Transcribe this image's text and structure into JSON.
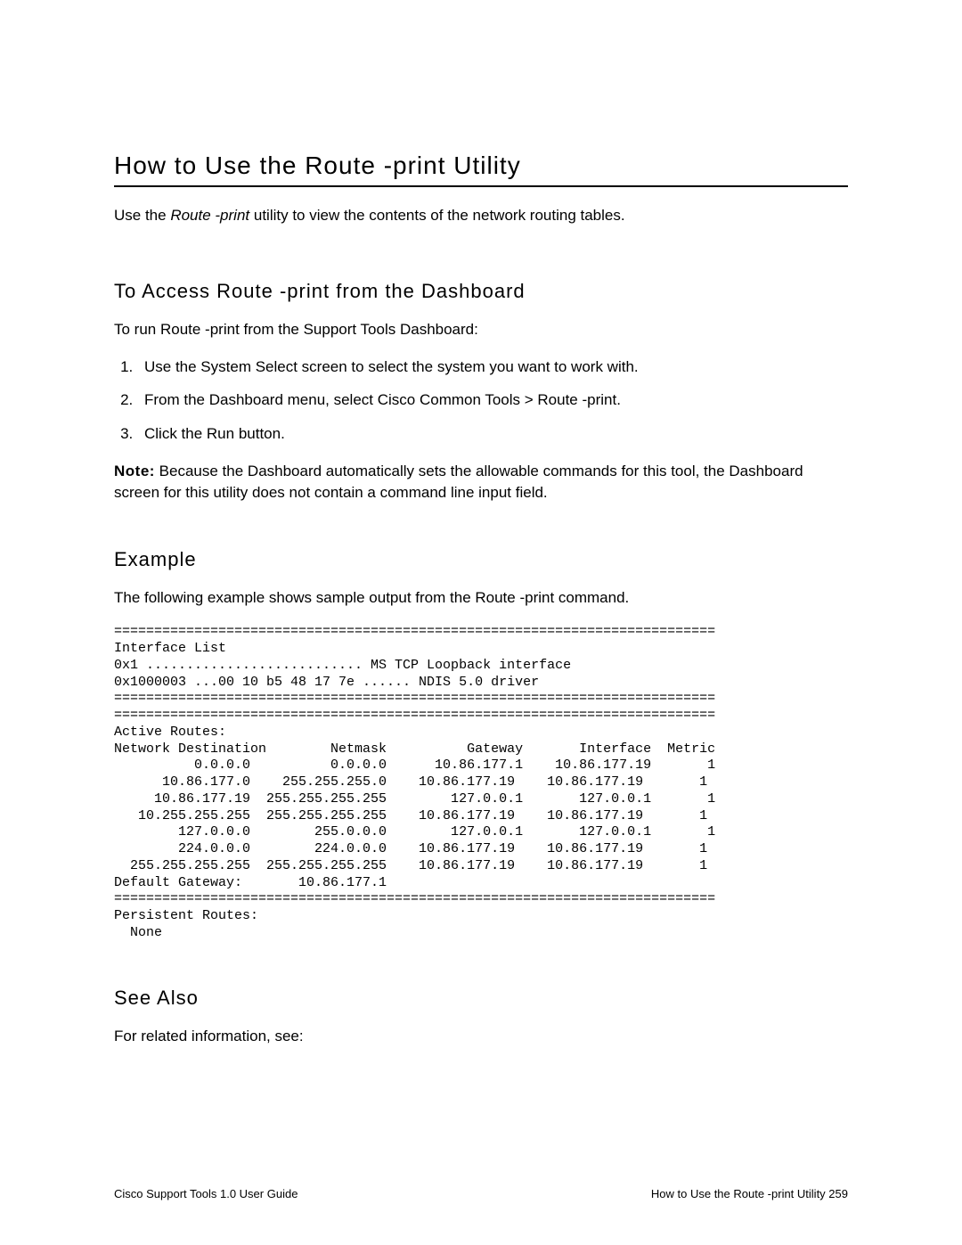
{
  "title": "How to Use the Route -print Utility",
  "intro_pre": "Use the ",
  "intro_em": "Route -print",
  "intro_post": " utility to view the contents of the network routing tables.",
  "section1": {
    "heading": "To Access Route -print from the Dashboard",
    "lead": "To run Route -print from the Support Tools Dashboard:",
    "steps": [
      "Use the System Select screen to select the system you want to work with.",
      "From the Dashboard menu, select Cisco Common Tools > Route -print.",
      "Click the Run button."
    ],
    "note_label": "Note:",
    "note_text": " Because the Dashboard automatically sets the allowable commands for this tool, the Dashboard screen for this utility does not contain a command line input field."
  },
  "section2": {
    "heading": "Example",
    "lead": "The following example shows sample output from the Route -print command.",
    "code": "===========================================================================\nInterface List\n0x1 ........................... MS TCP Loopback interface\n0x1000003 ...00 10 b5 48 17 7e ...... NDIS 5.0 driver\n===========================================================================\n===========================================================================\nActive Routes:\nNetwork Destination        Netmask          Gateway       Interface  Metric\n          0.0.0.0          0.0.0.0      10.86.177.1    10.86.177.19       1\n      10.86.177.0    255.255.255.0    10.86.177.19    10.86.177.19       1\n     10.86.177.19  255.255.255.255        127.0.0.1       127.0.0.1       1\n   10.255.255.255  255.255.255.255    10.86.177.19    10.86.177.19       1\n        127.0.0.0        255.0.0.0        127.0.0.1       127.0.0.1       1\n        224.0.0.0        224.0.0.0    10.86.177.19    10.86.177.19       1\n  255.255.255.255  255.255.255.255    10.86.177.19    10.86.177.19       1\nDefault Gateway:       10.86.177.1\n===========================================================================\nPersistent Routes:\n  None"
  },
  "section3": {
    "heading": "See Also",
    "lead": "For related information, see:"
  },
  "footer": {
    "left": "Cisco Support Tools 1.0 User Guide",
    "right": "How to Use the Route -print Utility   259"
  }
}
